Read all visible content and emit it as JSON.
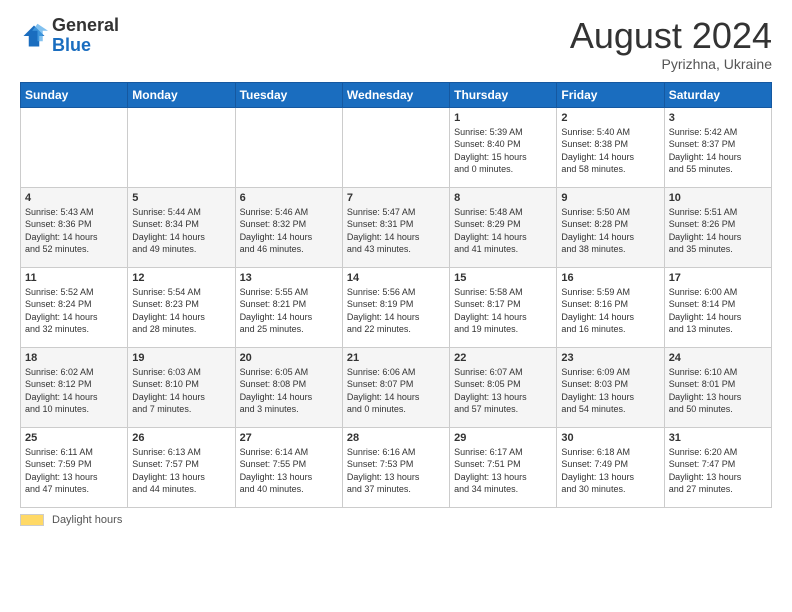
{
  "header": {
    "logo_general": "General",
    "logo_blue": "Blue",
    "month_title": "August 2024",
    "location": "Pyrizhna, Ukraine"
  },
  "footer": {
    "legend_label": "Daylight hours"
  },
  "days_of_week": [
    "Sunday",
    "Monday",
    "Tuesday",
    "Wednesday",
    "Thursday",
    "Friday",
    "Saturday"
  ],
  "weeks": [
    [
      {
        "day": "",
        "info": ""
      },
      {
        "day": "",
        "info": ""
      },
      {
        "day": "",
        "info": ""
      },
      {
        "day": "",
        "info": ""
      },
      {
        "day": "1",
        "info": "Sunrise: 5:39 AM\nSunset: 8:40 PM\nDaylight: 15 hours\nand 0 minutes."
      },
      {
        "day": "2",
        "info": "Sunrise: 5:40 AM\nSunset: 8:38 PM\nDaylight: 14 hours\nand 58 minutes."
      },
      {
        "day": "3",
        "info": "Sunrise: 5:42 AM\nSunset: 8:37 PM\nDaylight: 14 hours\nand 55 minutes."
      }
    ],
    [
      {
        "day": "4",
        "info": "Sunrise: 5:43 AM\nSunset: 8:36 PM\nDaylight: 14 hours\nand 52 minutes."
      },
      {
        "day": "5",
        "info": "Sunrise: 5:44 AM\nSunset: 8:34 PM\nDaylight: 14 hours\nand 49 minutes."
      },
      {
        "day": "6",
        "info": "Sunrise: 5:46 AM\nSunset: 8:32 PM\nDaylight: 14 hours\nand 46 minutes."
      },
      {
        "day": "7",
        "info": "Sunrise: 5:47 AM\nSunset: 8:31 PM\nDaylight: 14 hours\nand 43 minutes."
      },
      {
        "day": "8",
        "info": "Sunrise: 5:48 AM\nSunset: 8:29 PM\nDaylight: 14 hours\nand 41 minutes."
      },
      {
        "day": "9",
        "info": "Sunrise: 5:50 AM\nSunset: 8:28 PM\nDaylight: 14 hours\nand 38 minutes."
      },
      {
        "day": "10",
        "info": "Sunrise: 5:51 AM\nSunset: 8:26 PM\nDaylight: 14 hours\nand 35 minutes."
      }
    ],
    [
      {
        "day": "11",
        "info": "Sunrise: 5:52 AM\nSunset: 8:24 PM\nDaylight: 14 hours\nand 32 minutes."
      },
      {
        "day": "12",
        "info": "Sunrise: 5:54 AM\nSunset: 8:23 PM\nDaylight: 14 hours\nand 28 minutes."
      },
      {
        "day": "13",
        "info": "Sunrise: 5:55 AM\nSunset: 8:21 PM\nDaylight: 14 hours\nand 25 minutes."
      },
      {
        "day": "14",
        "info": "Sunrise: 5:56 AM\nSunset: 8:19 PM\nDaylight: 14 hours\nand 22 minutes."
      },
      {
        "day": "15",
        "info": "Sunrise: 5:58 AM\nSunset: 8:17 PM\nDaylight: 14 hours\nand 19 minutes."
      },
      {
        "day": "16",
        "info": "Sunrise: 5:59 AM\nSunset: 8:16 PM\nDaylight: 14 hours\nand 16 minutes."
      },
      {
        "day": "17",
        "info": "Sunrise: 6:00 AM\nSunset: 8:14 PM\nDaylight: 14 hours\nand 13 minutes."
      }
    ],
    [
      {
        "day": "18",
        "info": "Sunrise: 6:02 AM\nSunset: 8:12 PM\nDaylight: 14 hours\nand 10 minutes."
      },
      {
        "day": "19",
        "info": "Sunrise: 6:03 AM\nSunset: 8:10 PM\nDaylight: 14 hours\nand 7 minutes."
      },
      {
        "day": "20",
        "info": "Sunrise: 6:05 AM\nSunset: 8:08 PM\nDaylight: 14 hours\nand 3 minutes."
      },
      {
        "day": "21",
        "info": "Sunrise: 6:06 AM\nSunset: 8:07 PM\nDaylight: 14 hours\nand 0 minutes."
      },
      {
        "day": "22",
        "info": "Sunrise: 6:07 AM\nSunset: 8:05 PM\nDaylight: 13 hours\nand 57 minutes."
      },
      {
        "day": "23",
        "info": "Sunrise: 6:09 AM\nSunset: 8:03 PM\nDaylight: 13 hours\nand 54 minutes."
      },
      {
        "day": "24",
        "info": "Sunrise: 6:10 AM\nSunset: 8:01 PM\nDaylight: 13 hours\nand 50 minutes."
      }
    ],
    [
      {
        "day": "25",
        "info": "Sunrise: 6:11 AM\nSunset: 7:59 PM\nDaylight: 13 hours\nand 47 minutes."
      },
      {
        "day": "26",
        "info": "Sunrise: 6:13 AM\nSunset: 7:57 PM\nDaylight: 13 hours\nand 44 minutes."
      },
      {
        "day": "27",
        "info": "Sunrise: 6:14 AM\nSunset: 7:55 PM\nDaylight: 13 hours\nand 40 minutes."
      },
      {
        "day": "28",
        "info": "Sunrise: 6:16 AM\nSunset: 7:53 PM\nDaylight: 13 hours\nand 37 minutes."
      },
      {
        "day": "29",
        "info": "Sunrise: 6:17 AM\nSunset: 7:51 PM\nDaylight: 13 hours\nand 34 minutes."
      },
      {
        "day": "30",
        "info": "Sunrise: 6:18 AM\nSunset: 7:49 PM\nDaylight: 13 hours\nand 30 minutes."
      },
      {
        "day": "31",
        "info": "Sunrise: 6:20 AM\nSunset: 7:47 PM\nDaylight: 13 hours\nand 27 minutes."
      }
    ]
  ]
}
